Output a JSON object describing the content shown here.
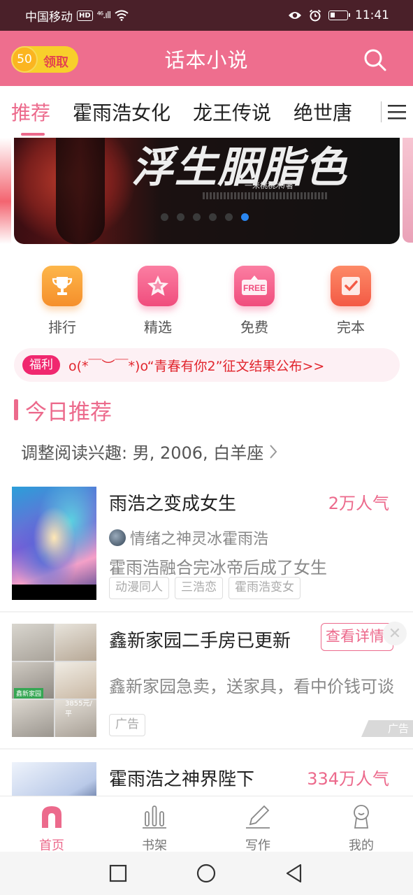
{
  "status_bar": {
    "carrier": "中国移动",
    "hd": "HD",
    "signal": "⁴⁶.ıll",
    "time": "11:41"
  },
  "header": {
    "coin_amount": "50",
    "coin_label": "领取",
    "title": "话本小说"
  },
  "tabs": [
    {
      "label": "推荐"
    },
    {
      "label": "霍雨浩女化"
    },
    {
      "label": "龙王传说"
    },
    {
      "label": "绝世唐"
    }
  ],
  "banner": {
    "title_art": "浮生胭脂色",
    "author": "一米桃桃木/著",
    "slide_count": 6,
    "active_slide": 6
  },
  "quick_actions": [
    {
      "label": "排行",
      "icon": "trophy-icon"
    },
    {
      "label": "精选",
      "icon": "star-icon"
    },
    {
      "label": "免费",
      "icon": "free-icon",
      "badge": "FREE"
    },
    {
      "label": "完本",
      "icon": "check-book-icon"
    }
  ],
  "notice": {
    "tag": "福利",
    "message": "o(*￣︶￣*)o“青春有你2”征文结果公布>>"
  },
  "section": {
    "title": "今日推荐",
    "interest": "调整阅读兴趣: 男, 2006, 白羊座"
  },
  "books": [
    {
      "title": "雨浩之变成女生",
      "popularity": "2万人气",
      "author": "情绪之神灵冰霍雨浩",
      "description": "霍雨浩融合完冰帝后成了女生",
      "tags": [
        "动漫同人",
        "三浩恋",
        "霍雨浩变女"
      ]
    },
    {
      "title": "霍雨浩之神界陛下",
      "popularity": "334万人气"
    }
  ],
  "ad": {
    "title": "鑫新家园二手房已更新",
    "button": "查看详情",
    "description": "鑫新家园急卖，送家具，看中价钱可谈",
    "tag": "广告",
    "mark": "广告",
    "cover_logo": "鑫新家园",
    "cover_price": "3855元/平"
  },
  "bottom_nav": [
    {
      "label": "首页",
      "active": true
    },
    {
      "label": "书架",
      "active": false
    },
    {
      "label": "写作",
      "active": false
    },
    {
      "label": "我的",
      "active": false
    }
  ],
  "colors": {
    "accent": "#ec6a8c",
    "header": "#ee6e8e",
    "status_bar": "#4a2029"
  }
}
